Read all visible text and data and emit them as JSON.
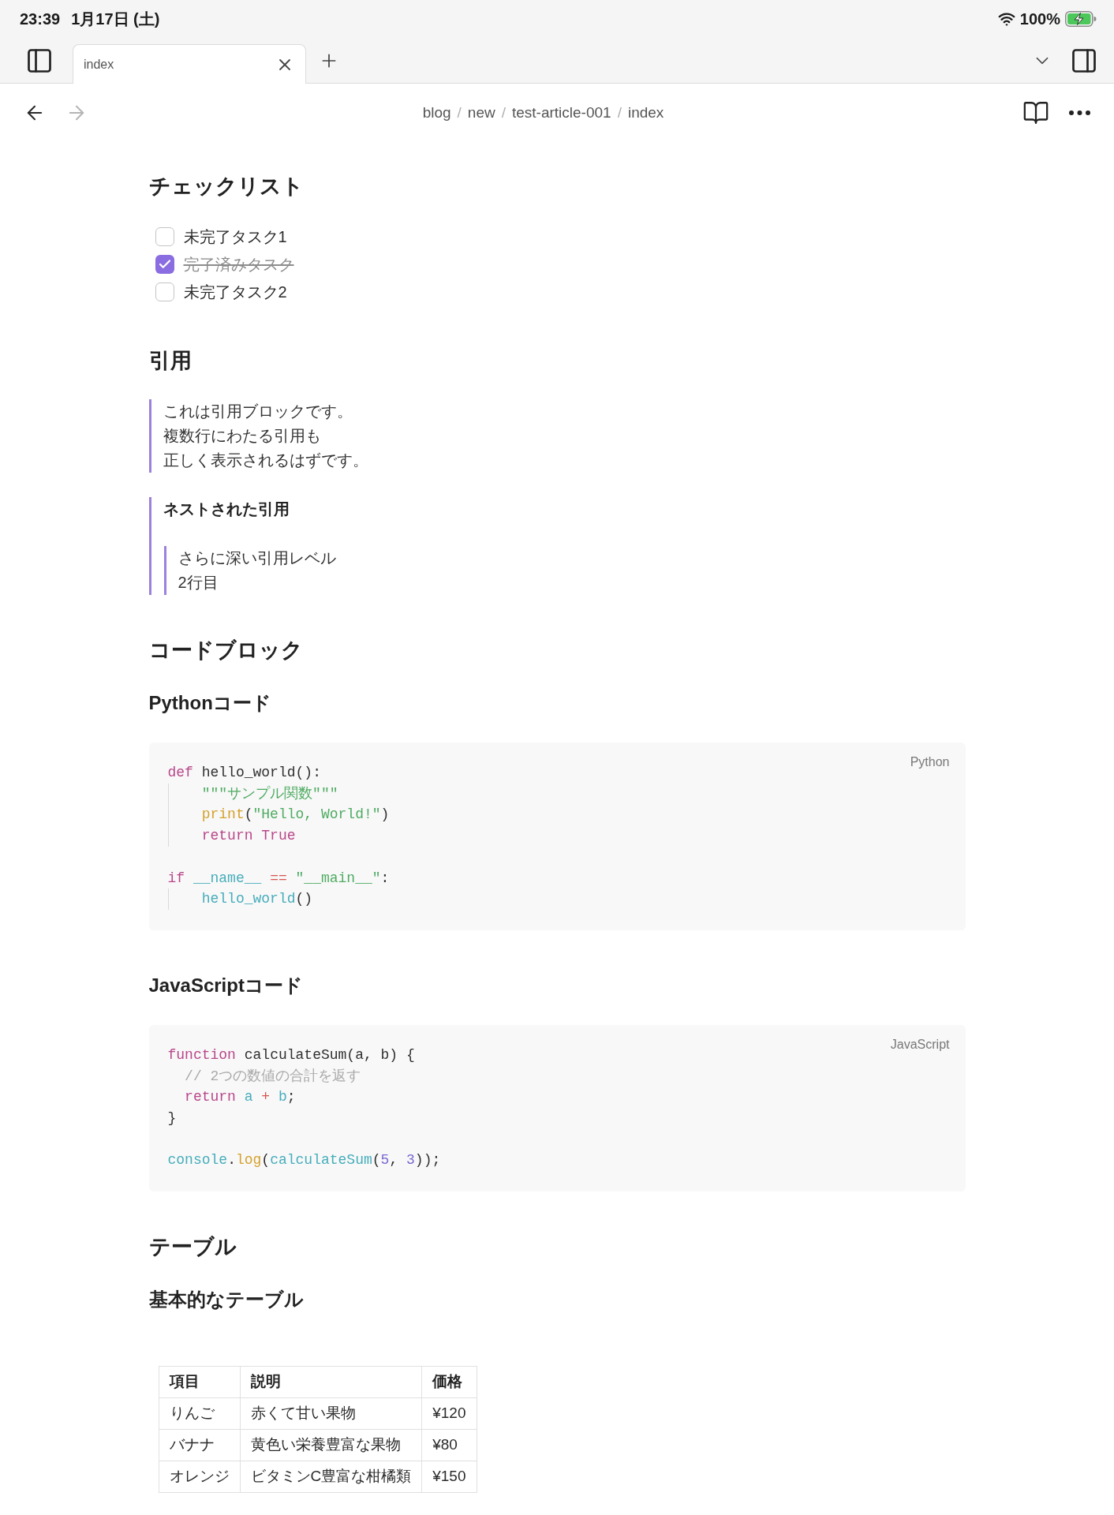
{
  "status_bar": {
    "time": "23:39",
    "date": "1月17日 (土)",
    "battery": "100%"
  },
  "tab_bar": {
    "tabs": [
      {
        "label": "index",
        "selected": true
      }
    ]
  },
  "nav_bar": {
    "back": {
      "disabled": false
    },
    "forward": {
      "disabled": true
    },
    "breadcrumb": [
      {
        "kind": "link",
        "text": "blog"
      },
      {
        "kind": "separator",
        "text": "/"
      },
      {
        "kind": "link",
        "text": "new"
      },
      {
        "kind": "separator",
        "text": "/"
      },
      {
        "kind": "link",
        "text": "test-article-001"
      },
      {
        "kind": "separator",
        "text": "/"
      },
      {
        "kind": "link",
        "text": "index"
      }
    ]
  },
  "document": [
    {
      "kind": "h2",
      "text": "チェックリスト"
    },
    {
      "kind": "checklist",
      "items": [
        {
          "label": "未完了タスク1",
          "checked": false
        },
        {
          "label": "完了済みタスク",
          "checked": true
        },
        {
          "label": "未完了タスク2",
          "checked": false
        }
      ]
    },
    {
      "kind": "h2",
      "text": "引用"
    },
    {
      "kind": "quote",
      "lines": [
        "これは引用ブロックです。",
        "複数行にわたる引用も",
        "正しく表示されるはずです。"
      ]
    },
    {
      "kind": "quote",
      "title": "ネストされた引用",
      "nested": {
        "lines": [
          "さらに深い引用レベル",
          "2行目"
        ]
      }
    },
    {
      "kind": "h2",
      "text": "コードブロック"
    },
    {
      "kind": "h3",
      "text": "Pythonコード"
    },
    {
      "kind": "code",
      "language": "Python",
      "groups": [
        {
          "lines": [
            {
              "guide": false,
              "tokens": [
                {
                  "kind": "keyword",
                  "text": "def"
                },
                {
                  "kind": "plain",
                  "text": " hello_world():"
                }
              ]
            },
            {
              "guide": true,
              "tokens": [
                {
                  "kind": "string",
                  "text": "\"\"\"サンプル関数\"\"\""
                }
              ]
            },
            {
              "guide": true,
              "tokens": [
                {
                  "kind": "builtin",
                  "text": "print"
                },
                {
                  "kind": "plain",
                  "text": "("
                },
                {
                  "kind": "string",
                  "text": "\"Hello, World!\""
                },
                {
                  "kind": "plain",
                  "text": ")"
                }
              ]
            },
            {
              "guide": true,
              "tokens": [
                {
                  "kind": "keyword",
                  "text": "return True"
                }
              ]
            }
          ]
        },
        {
          "lines": [
            {
              "guide": false,
              "tokens": [
                {
                  "kind": "keyword",
                  "text": "if"
                },
                {
                  "kind": "variable",
                  "text": " __name__"
                },
                {
                  "kind": "operator",
                  "text": " =="
                },
                {
                  "kind": "string",
                  "text": " \"__main__\""
                },
                {
                  "kind": "plain",
                  "text": ":"
                }
              ]
            },
            {
              "guide": true,
              "tokens": [
                {
                  "kind": "variable",
                  "text": "hello_world"
                },
                {
                  "kind": "plain",
                  "text": "()"
                }
              ]
            }
          ]
        }
      ]
    },
    {
      "kind": "h3",
      "text": "JavaScriptコード"
    },
    {
      "kind": "code",
      "language": "JavaScript",
      "groups": [
        {
          "lines": [
            {
              "guide": false,
              "tokens": [
                {
                  "kind": "keyword",
                  "text": "function"
                },
                {
                  "kind": "plain",
                  "text": " calculateSum(a, b) {"
                }
              ]
            },
            {
              "guide": false,
              "tokens": [
                {
                  "kind": "comment",
                  "text": "  // 2つの数値の合計を返す"
                }
              ]
            },
            {
              "guide": false,
              "tokens": [
                {
                  "kind": "keyword",
                  "text": "  return"
                },
                {
                  "kind": "variable",
                  "text": " a"
                },
                {
                  "kind": "operator",
                  "text": " +"
                },
                {
                  "kind": "variable",
                  "text": " b"
                },
                {
                  "kind": "plain",
                  "text": ";"
                }
              ]
            },
            {
              "guide": false,
              "tokens": [
                {
                  "kind": "plain",
                  "text": "}"
                }
              ]
            }
          ]
        },
        {
          "lines": [
            {
              "guide": false,
              "tokens": [
                {
                  "kind": "variable",
                  "text": "console"
                },
                {
                  "kind": "plain",
                  "text": "."
                },
                {
                  "kind": "builtin",
                  "text": "log"
                },
                {
                  "kind": "plain",
                  "text": "("
                },
                {
                  "kind": "variable",
                  "text": "calculateSum"
                },
                {
                  "kind": "plain",
                  "text": "("
                },
                {
                  "kind": "number",
                  "text": "5"
                },
                {
                  "kind": "plain",
                  "text": ", "
                },
                {
                  "kind": "number",
                  "text": "3"
                },
                {
                  "kind": "plain",
                  "text": "));"
                }
              ]
            }
          ]
        }
      ]
    },
    {
      "kind": "h2",
      "text": "テーブル"
    },
    {
      "kind": "h3",
      "text": "基本的なテーブル"
    },
    {
      "kind": "table",
      "columns": [
        "項目",
        "説明",
        "価格"
      ],
      "rows": [
        [
          "りんご",
          "赤くて甘い果物",
          "¥120"
        ],
        [
          "バナナ",
          "黄色い栄養豊富な果物",
          "¥80"
        ],
        [
          "オレンジ",
          "ビタミンC豊富な柑橘類",
          "¥150"
        ]
      ]
    }
  ]
}
